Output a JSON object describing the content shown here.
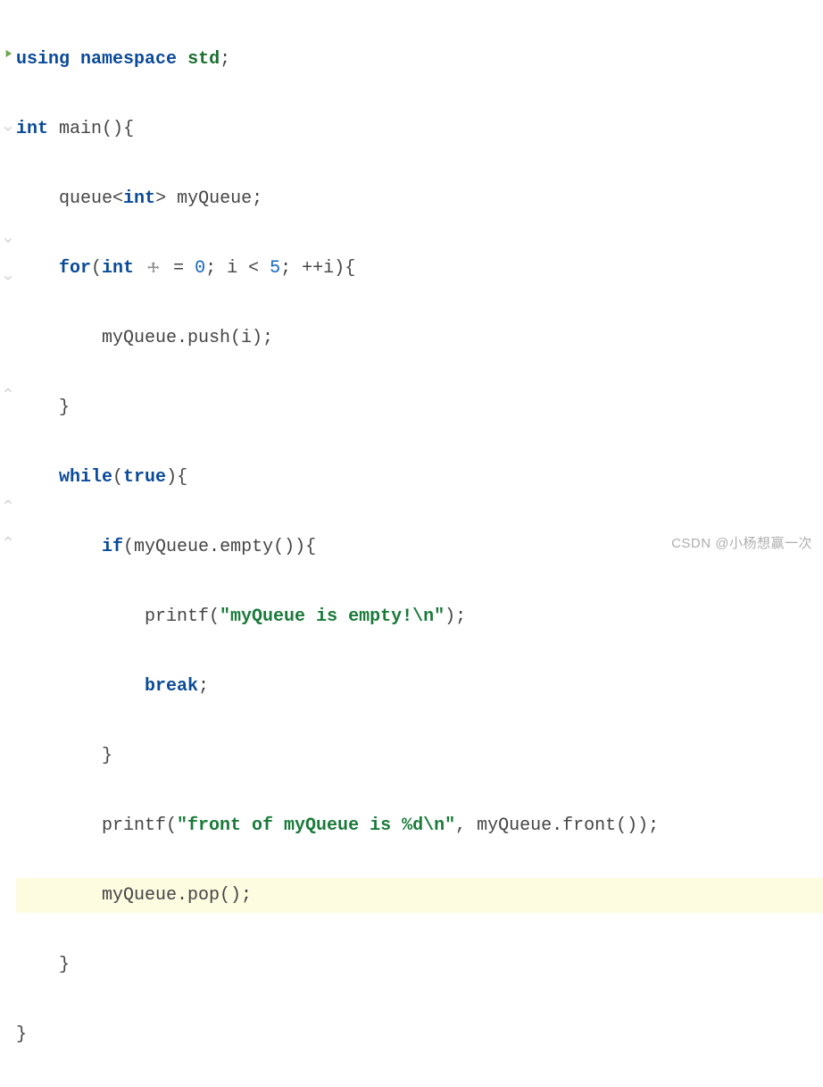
{
  "code": {
    "l1": {
      "using": "using",
      "namespace": "namespace",
      "std": "std",
      "semi": ";"
    },
    "l2": {
      "int": "int",
      "main": "main",
      "parens": "()",
      "brace": "{"
    },
    "l3": {
      "queue": "queue",
      "lt": "<",
      "inttype": "int",
      "gt": ">",
      "var": " myQueue",
      "semi": ";"
    },
    "l4": {
      "for": "for",
      "open": "(",
      "int": "int ",
      "eq": " = ",
      "zero": "0",
      "semi1": "; ",
      "cond": "i < ",
      "five": "5",
      "semi2": "; ",
      "inc": "++i",
      "close": ")",
      "brace": "{"
    },
    "l5": {
      "call": "myQueue.push(i)",
      "semi": ";"
    },
    "l6": {
      "close": "}"
    },
    "l7": {
      "while": "while",
      "open": "(",
      "true": "true",
      "close": ")",
      "brace": "{"
    },
    "l8": {
      "if": "if",
      "open": "(",
      "cond": "myQueue.empty()",
      "close": ")",
      "brace": "{"
    },
    "l9": {
      "printf": "printf(",
      "str": "\"myQueue is empty!\\n\"",
      "close": ")",
      "semi": ";"
    },
    "l10": {
      "break": "break",
      "semi": ";"
    },
    "l11": {
      "close": "}"
    },
    "l12": {
      "printf": "printf(",
      "str": "\"front of myQueue is %d\\n\"",
      "rest": ", myQueue.front())",
      "semi": ";"
    },
    "l13": {
      "call": "myQueue.pop()",
      "semi": ";"
    },
    "l14": {
      "close": "}"
    },
    "l15": {
      "close": "}"
    }
  },
  "watermark": "CSDN @小杨想赢一次"
}
